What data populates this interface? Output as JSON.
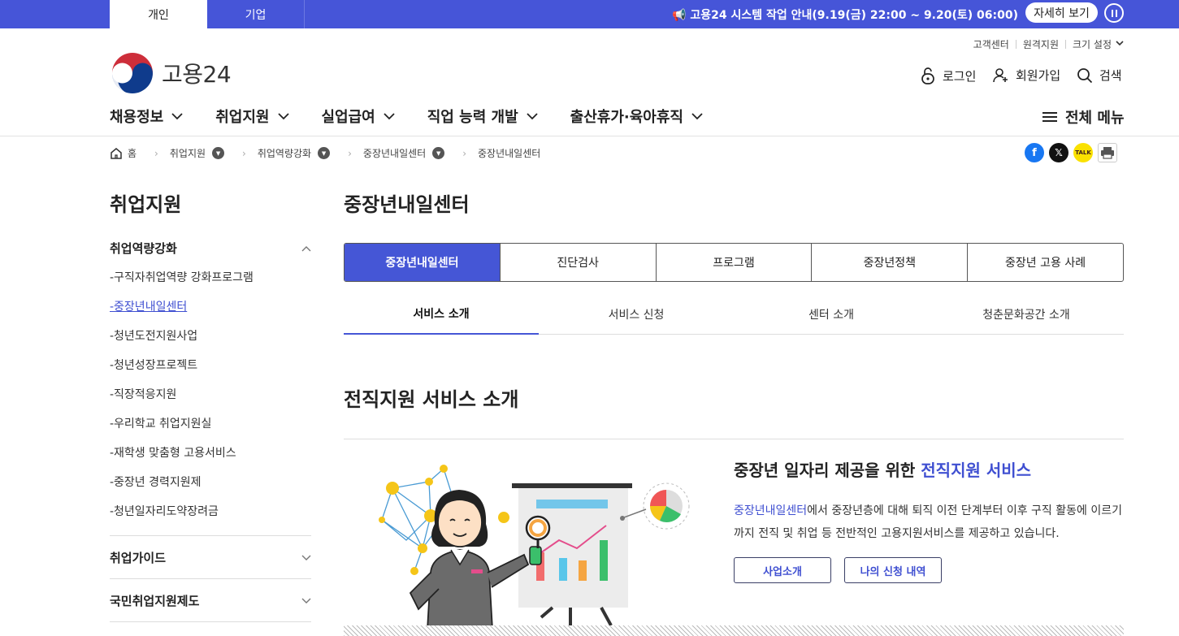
{
  "topbar": {
    "tabs": [
      "개인",
      "기업"
    ],
    "notice": "📢 고용24 시스템 작업 안내(9.19(금) 22:00 ~ 9.20(토) 06:00)",
    "detail_label": "자세히 보기"
  },
  "util": {
    "items": [
      "고객센터",
      "원격지원",
      "크기 설정"
    ]
  },
  "logo": {
    "text": "고용24"
  },
  "account": {
    "login": "로그인",
    "join": "회원가입",
    "search": "검색"
  },
  "gnb": {
    "items": [
      "채용정보",
      "취업지원",
      "실업급여",
      "직업 능력 개발",
      "출산휴가·육아휴직"
    ],
    "all_menu": "전체 메뉴"
  },
  "breadcrumb": {
    "items": [
      "홈",
      "취업지원",
      "취업역량강화",
      "중장년내일센터",
      "중장년내일센터"
    ]
  },
  "sidebar": {
    "title": "취업지원",
    "groups": [
      "취업역량강화",
      "취업가이드",
      "국민취업지원제도"
    ],
    "sub_items": [
      "-구직자취업역량 강화프로그램",
      "-중장년내일센터",
      "-청년도전지원사업",
      "-청년성장프로젝트",
      "-직장적응지원",
      "-우리학교 취업지원실",
      "-재학생 맞춤형 고용서비스",
      "-중장년 경력지원제",
      "-청년일자리도약장려금"
    ]
  },
  "main": {
    "title": "중장년내일센터",
    "tabs": [
      "중장년내일센터",
      "진단검사",
      "프로그램",
      "중장년정책",
      "중장년 고용 사례"
    ],
    "subtabs": [
      "서비스 소개",
      "서비스 신청",
      "센터 소개",
      "청춘문화공간 소개"
    ],
    "section_title": "전직지원 서비스 소개",
    "service": {
      "head_pre": "중장년 일자리 제공을 위한 ",
      "head_hl": "전직지원 서비스",
      "desc_hl": "중장년내일센터",
      "desc_rest": "에서 중장년층에 대해 퇴직 이전 단계부터 이후 구직 활동에 이르기까지 전직 및 취업 등 전반적인 고용지원서비스를 제공하고 있습니다.",
      "btn1": "사업소개",
      "btn2": "나의 신청 내역"
    }
  },
  "colors": {
    "brand": "#4655d8",
    "accent_text": "#3f4fd1"
  }
}
